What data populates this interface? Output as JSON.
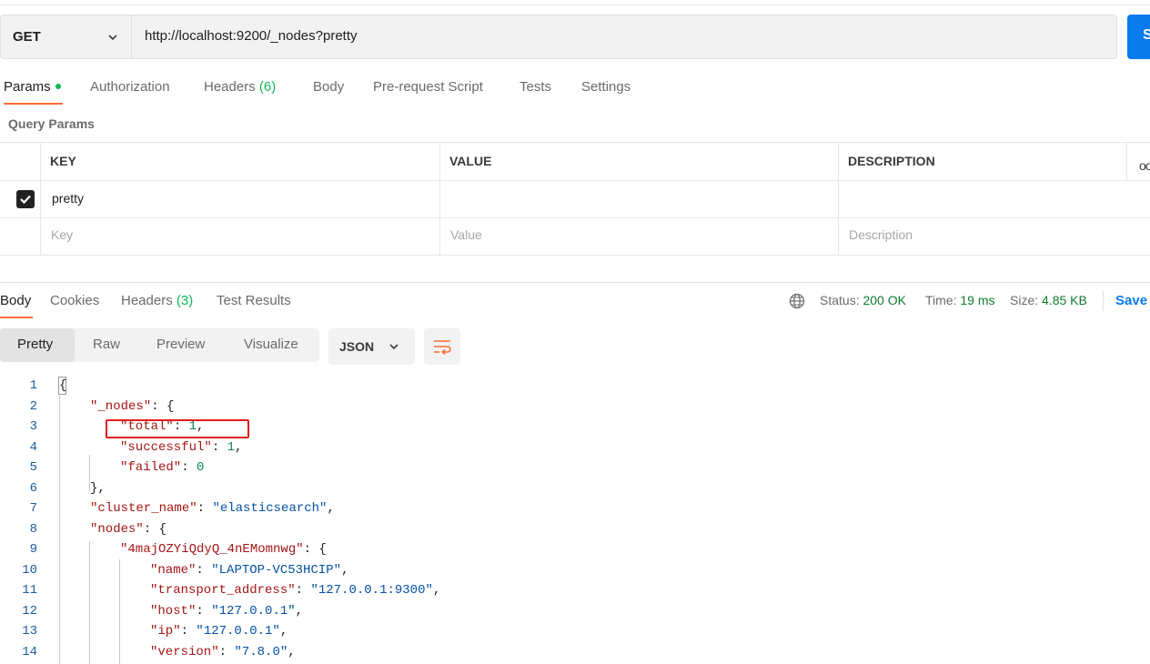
{
  "request": {
    "method": "GET",
    "url": "http://localhost:9200/_nodes?pretty",
    "send_label": "S"
  },
  "request_tabs": [
    {
      "label": "Params",
      "active": true,
      "dot": true
    },
    {
      "label": "Authorization"
    },
    {
      "label": "Headers",
      "count": "(6)"
    },
    {
      "label": "Body"
    },
    {
      "label": "Pre-request Script"
    },
    {
      "label": "Tests"
    },
    {
      "label": "Settings"
    }
  ],
  "query_params": {
    "title": "Query Params",
    "columns": [
      "KEY",
      "VALUE",
      "DESCRIPTION"
    ],
    "rows": [
      {
        "key": "pretty",
        "value": "",
        "description": "",
        "checked": true
      }
    ],
    "placeholders": {
      "key": "Key",
      "value": "Value",
      "description": "Description"
    }
  },
  "response_tabs": [
    {
      "label": "Body",
      "active": true
    },
    {
      "label": "Cookies"
    },
    {
      "label": "Headers",
      "count": "(3)"
    },
    {
      "label": "Test Results"
    }
  ],
  "status": {
    "status_label": "Status:",
    "status_value": "200 OK",
    "time_label": "Time:",
    "time_value": "19 ms",
    "size_label": "Size:",
    "size_value": "4.85 KB",
    "save_label": "Save"
  },
  "view_modes": [
    "Pretty",
    "Raw",
    "Preview",
    "Visualize"
  ],
  "format": "JSON",
  "code_lines": [
    {
      "n": "1"
    },
    {
      "n": "2"
    },
    {
      "n": "3"
    },
    {
      "n": "4"
    },
    {
      "n": "5"
    },
    {
      "n": "6"
    },
    {
      "n": "7"
    },
    {
      "n": "8"
    },
    {
      "n": "9"
    },
    {
      "n": "10"
    },
    {
      "n": "11"
    },
    {
      "n": "12"
    },
    {
      "n": "13"
    },
    {
      "n": "14"
    }
  ],
  "code": {
    "l1": "{",
    "l2_key": "\"_nodes\"",
    "l2_rest": ": {",
    "l3_key": "\"total\"",
    "l3_val": "1",
    "l4_key": "\"successful\"",
    "l4_val": "1",
    "l5_key": "\"failed\"",
    "l5_val": "0",
    "l6": "},",
    "l7_key": "\"cluster_name\"",
    "l7_val": "\"elasticsearch\"",
    "l8_key": "\"nodes\"",
    "l8_rest": ": {",
    "l9_key": "\"4majOZYiQdyQ_4nEMomnwg\"",
    "l9_rest": ": {",
    "l10_key": "\"name\"",
    "l10_val": "\"LAPTOP-VC53HCIP\"",
    "l11_key": "\"transport_address\"",
    "l11_val": "\"127.0.0.1:9300\"",
    "l12_key": "\"host\"",
    "l12_val": "\"127.0.0.1\"",
    "l13_key": "\"ip\"",
    "l13_val": "\"127.0.0.1\"",
    "l14_key": "\"version\"",
    "l14_val": "\"7.8.0\""
  },
  "colors": {
    "accent": "#ff6c37",
    "primary": "#097bed",
    "success": "#0cbb52",
    "highlight_box": "#e01e1e"
  }
}
